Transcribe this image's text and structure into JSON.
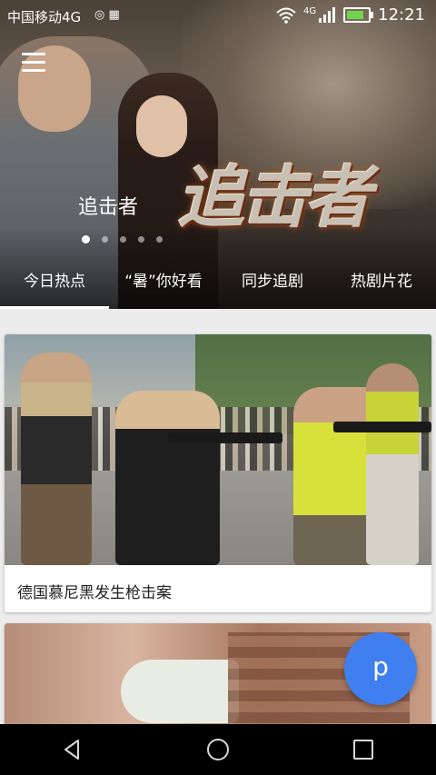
{
  "status_bar": {
    "carrier": "中国移动4G",
    "network": "4G",
    "time": "12:21",
    "battery_level": 0.8,
    "battery_color": "#6fd34e"
  },
  "hero": {
    "logo_text": "追击者",
    "caption": "追击者",
    "slide_count": 5,
    "active_slide": 0
  },
  "tabs": [
    {
      "label": "今日热点",
      "active": true
    },
    {
      "label": "“暑”你好看",
      "active": false
    },
    {
      "label": "同步追剧",
      "active": false
    },
    {
      "label": "热剧片花",
      "active": false
    }
  ],
  "feed": [
    {
      "title": "德国慕尼黑发生枪击案"
    }
  ],
  "fab": {
    "label": "p",
    "color": "#3f7fef"
  },
  "nav": {
    "back_icon": "back-triangle-icon",
    "home_icon": "home-circle-icon",
    "recents_icon": "recents-square-icon"
  }
}
